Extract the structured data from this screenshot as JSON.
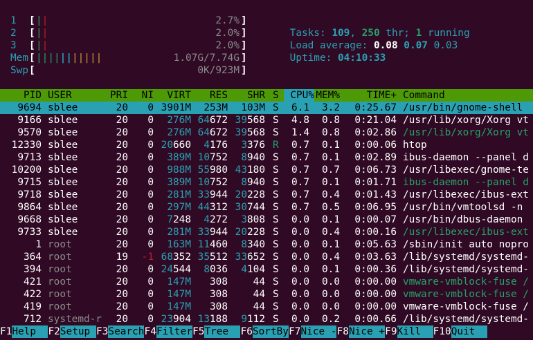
{
  "meters": {
    "cpus": [
      {
        "label": "1",
        "bars": "||",
        "value": "2.7%"
      },
      {
        "label": "2",
        "bars": "||",
        "value": "2.0%"
      },
      {
        "label": "3",
        "bars": "||",
        "value": "2.0%"
      }
    ],
    "mem": {
      "label": "Mem",
      "bars": "|||||||||||",
      "value": "1.07G/7.74G"
    },
    "swp": {
      "label": "Swp",
      "bars": "",
      "value": "0K/923M"
    }
  },
  "summary": {
    "tasks_label": "Tasks: ",
    "tasks": "109",
    "sep1": ", ",
    "threads": "250",
    "thr_label": " thr; ",
    "running": "1",
    "running_label": " running",
    "load_label": "Load average: ",
    "load1": "0.08",
    "load5": "0.07",
    "load15": "0.03",
    "uptime_label": "Uptime: ",
    "uptime": "04:10:33"
  },
  "columns": [
    "PID",
    "USER",
    "PRI",
    "NI",
    "VIRT",
    "RES",
    "SHR",
    "S",
    "CPU%",
    "MEM%",
    "TIME+",
    "Command"
  ],
  "sort_column": "CPU%",
  "processes": [
    {
      "pid": "9694",
      "user": "sblee",
      "pri": "20",
      "ni": "0",
      "virt": "3901M",
      "res": "253M",
      "shr": "103M",
      "s": "S",
      "cpu": "6.1",
      "mem": "3.2",
      "time": "0:25.67",
      "cmd": "/usr/bin/gnome-shell",
      "selected": true
    },
    {
      "pid": "9166",
      "user": "sblee",
      "pri": "20",
      "ni": "0",
      "virt": "276M",
      "res": "64672",
      "shr": "39568",
      "s": "S",
      "cpu": "4.8",
      "mem": "0.8",
      "time": "0:21.04",
      "cmd": "/usr/lib/xorg/Xorg vt"
    },
    {
      "pid": "9570",
      "user": "sblee",
      "pri": "20",
      "ni": "0",
      "virt": "276M",
      "res": "64672",
      "shr": "39568",
      "s": "S",
      "cpu": "1.4",
      "mem": "0.8",
      "time": "0:02.86",
      "cmd": "/usr/lib/xorg/Xorg vt",
      "thread": true
    },
    {
      "pid": "12330",
      "user": "sblee",
      "pri": "20",
      "ni": "0",
      "virt": "20660",
      "res": "4176",
      "shr": "3376",
      "s": "R",
      "cpu": "0.7",
      "mem": "0.1",
      "time": "0:00.06",
      "cmd": "htop"
    },
    {
      "pid": "9713",
      "user": "sblee",
      "pri": "20",
      "ni": "0",
      "virt": "389M",
      "res": "10752",
      "shr": "8940",
      "s": "S",
      "cpu": "0.7",
      "mem": "0.1",
      "time": "0:02.89",
      "cmd": "ibus-daemon --panel d"
    },
    {
      "pid": "10200",
      "user": "sblee",
      "pri": "20",
      "ni": "0",
      "virt": "988M",
      "res": "55980",
      "shr": "43180",
      "s": "S",
      "cpu": "0.7",
      "mem": "0.7",
      "time": "0:06.73",
      "cmd": "/usr/libexec/gnome-te"
    },
    {
      "pid": "9715",
      "user": "sblee",
      "pri": "20",
      "ni": "0",
      "virt": "389M",
      "res": "10752",
      "shr": "8940",
      "s": "S",
      "cpu": "0.7",
      "mem": "0.1",
      "time": "0:01.71",
      "cmd": "ibus-daemon --panel d",
      "thread": true
    },
    {
      "pid": "9718",
      "user": "sblee",
      "pri": "20",
      "ni": "0",
      "virt": "281M",
      "res": "33944",
      "shr": "20228",
      "s": "S",
      "cpu": "0.7",
      "mem": "0.4",
      "time": "0:01.43",
      "cmd": "/usr/libexec/ibus-ext"
    },
    {
      "pid": "9864",
      "user": "sblee",
      "pri": "20",
      "ni": "0",
      "virt": "297M",
      "res": "44312",
      "shr": "30744",
      "s": "S",
      "cpu": "0.7",
      "mem": "0.5",
      "time": "0:06.95",
      "cmd": "/usr/bin/vmtoolsd -n"
    },
    {
      "pid": "9668",
      "user": "sblee",
      "pri": "20",
      "ni": "0",
      "virt": "7248",
      "res": "4272",
      "shr": "3808",
      "s": "S",
      "cpu": "0.0",
      "mem": "0.1",
      "time": "0:00.07",
      "cmd": "/usr/bin/dbus-daemon"
    },
    {
      "pid": "9733",
      "user": "sblee",
      "pri": "20",
      "ni": "0",
      "virt": "281M",
      "res": "33944",
      "shr": "20228",
      "s": "S",
      "cpu": "0.0",
      "mem": "0.4",
      "time": "0:00.16",
      "cmd": "/usr/libexec/ibus-ext",
      "thread": true
    },
    {
      "pid": "1",
      "user": "root",
      "pri": "20",
      "ni": "0",
      "virt": "163M",
      "res": "11460",
      "shr": "8340",
      "s": "S",
      "cpu": "0.0",
      "mem": "0.1",
      "time": "0:05.63",
      "cmd": "/sbin/init auto nopro"
    },
    {
      "pid": "364",
      "user": "root",
      "pri": "19",
      "ni": "-1",
      "virt": "68352",
      "res": "35512",
      "shr": "33652",
      "s": "S",
      "cpu": "0.0",
      "mem": "0.4",
      "time": "0:03.63",
      "cmd": "/lib/systemd/systemd-"
    },
    {
      "pid": "394",
      "user": "root",
      "pri": "20",
      "ni": "0",
      "virt": "24544",
      "res": "8036",
      "shr": "4104",
      "s": "S",
      "cpu": "0.0",
      "mem": "0.1",
      "time": "0:00.36",
      "cmd": "/lib/systemd/systemd-"
    },
    {
      "pid": "421",
      "user": "root",
      "pri": "20",
      "ni": "0",
      "virt": "147M",
      "res": "308",
      "shr": "44",
      "s": "S",
      "cpu": "0.0",
      "mem": "0.0",
      "time": "0:00.00",
      "cmd": "vmware-vmblock-fuse /",
      "thread": true
    },
    {
      "pid": "422",
      "user": "root",
      "pri": "20",
      "ni": "0",
      "virt": "147M",
      "res": "308",
      "shr": "44",
      "s": "S",
      "cpu": "0.0",
      "mem": "0.0",
      "time": "0:00.00",
      "cmd": "vmware-vmblock-fuse /",
      "thread": true
    },
    {
      "pid": "419",
      "user": "root",
      "pri": "20",
      "ni": "0",
      "virt": "147M",
      "res": "308",
      "shr": "44",
      "s": "S",
      "cpu": "0.0",
      "mem": "0.0",
      "time": "0:00.00",
      "cmd": "vmware-vmblock-fuse /"
    },
    {
      "pid": "712",
      "user": "systemd-r",
      "pri": "20",
      "ni": "0",
      "virt": "23904",
      "res": "13188",
      "shr": "9112",
      "s": "S",
      "cpu": "0.0",
      "mem": "0.2",
      "time": "0:00.66",
      "cmd": "/lib/systemd/systemd-"
    }
  ],
  "function_keys": [
    {
      "key": "F1",
      "label": "Help  "
    },
    {
      "key": "F2",
      "label": "Setup "
    },
    {
      "key": "F3",
      "label": "Search"
    },
    {
      "key": "F4",
      "label": "Filter"
    },
    {
      "key": "F5",
      "label": "Tree  "
    },
    {
      "key": "F6",
      "label": "SortBy"
    },
    {
      "key": "F7",
      "label": "Nice -"
    },
    {
      "key": "F8",
      "label": "Nice +"
    },
    {
      "key": "F9",
      "label": "Kill  "
    },
    {
      "key": "F10",
      "label": "Quit  "
    }
  ],
  "colors": {
    "background": "#300a24",
    "cyan": "#2aa1b3",
    "green": "#4e9a06",
    "red": "#c01c28"
  }
}
